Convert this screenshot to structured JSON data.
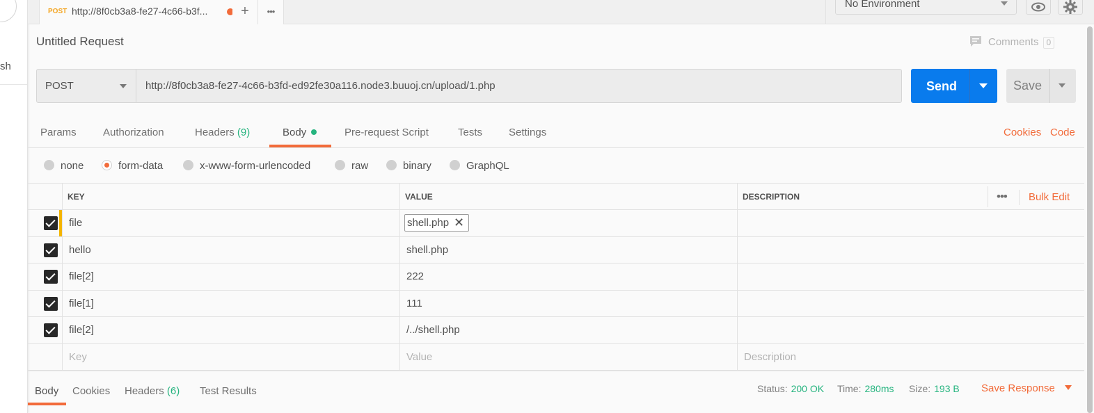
{
  "sidebar": {
    "fragment_text": "sh"
  },
  "tabbar": {
    "tab": {
      "method": "POST",
      "title": "http://8f0cb3a8-fe27-4c66-b3f..."
    },
    "add_icon": "+",
    "more_icon": "•••"
  },
  "environment": {
    "selected": "No Environment"
  },
  "request": {
    "name": "Untitled Request",
    "comments_label": "Comments",
    "comments_count": "0",
    "method": "POST",
    "url": "http://8f0cb3a8-fe27-4c66-b3fd-ed92fe30a116.node3.buuoj.cn/upload/1.php",
    "send_label": "Send",
    "save_label": "Save"
  },
  "req_tabs": {
    "params": "Params",
    "authorization": "Authorization",
    "headers": "Headers",
    "headers_count": "(9)",
    "body": "Body",
    "prerequest": "Pre-request Script",
    "tests": "Tests",
    "settings": "Settings",
    "cookies": "Cookies",
    "code": "Code"
  },
  "body_types": {
    "none": "none",
    "form_data": "form-data",
    "urlencoded": "x-www-form-urlencoded",
    "raw": "raw",
    "binary": "binary",
    "graphql": "GraphQL",
    "selected": "form-data"
  },
  "table": {
    "headers": {
      "key": "KEY",
      "value": "VALUE",
      "description": "DESCRIPTION"
    },
    "bulk_edit": "Bulk Edit",
    "rows": [
      {
        "key": "file",
        "value": "shell.php",
        "is_file": true
      },
      {
        "key": "hello",
        "value": "shell.php"
      },
      {
        "key": "file[2]",
        "value": "222"
      },
      {
        "key": "file[1]",
        "value": "111"
      },
      {
        "key": "file[2]",
        "value": "/../shell.php"
      }
    ],
    "placeholders": {
      "key": "Key",
      "value": "Value",
      "description": "Description"
    }
  },
  "response": {
    "tabs": {
      "body": "Body",
      "cookies": "Cookies",
      "headers": "Headers",
      "headers_count": "(6)",
      "test_results": "Test Results"
    },
    "status_label": "Status:",
    "status_value": "200 OK",
    "time_label": "Time:",
    "time_value": "280ms",
    "size_label": "Size:",
    "size_value": "193 B",
    "save_response": "Save Response"
  },
  "colors": {
    "accent": "#f26b3a",
    "send": "#097bed",
    "success": "#26b47f",
    "method_post": "#f4a623"
  }
}
